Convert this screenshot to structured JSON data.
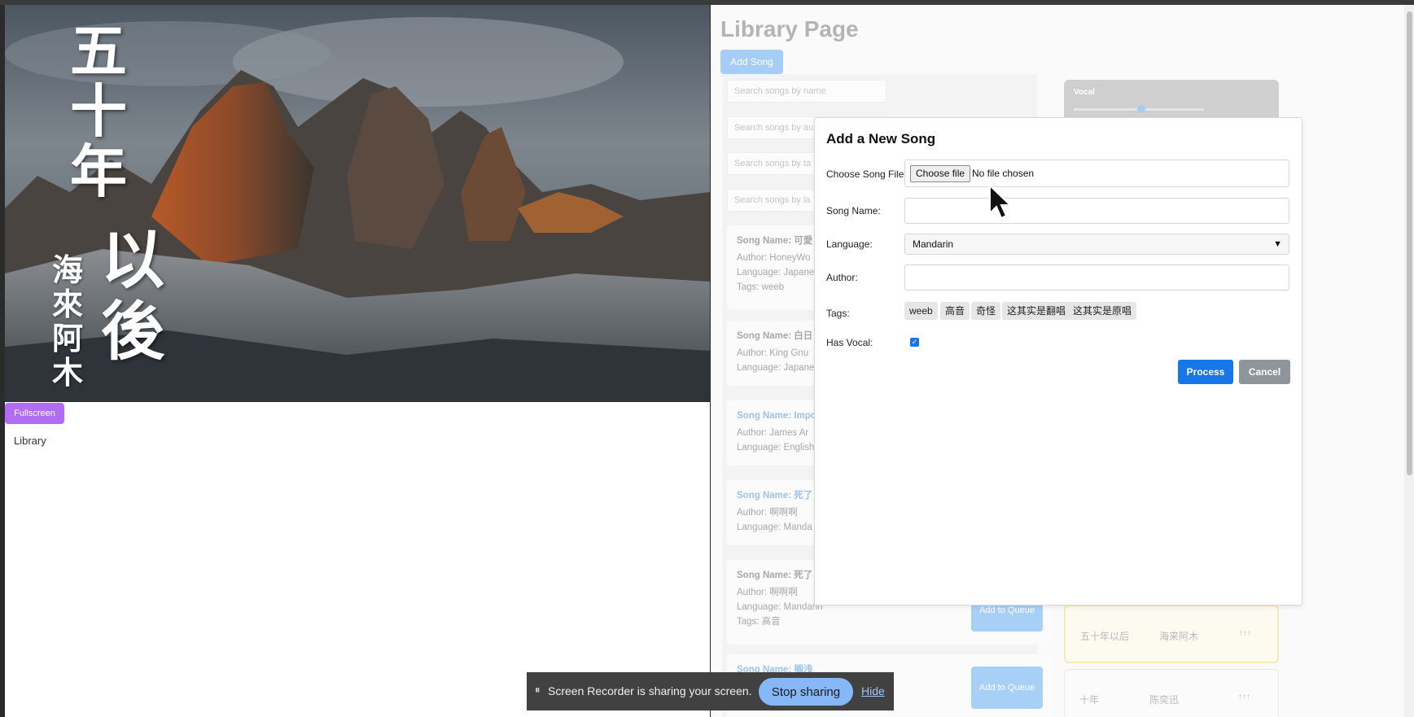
{
  "left": {
    "video_title_chars": "五十年",
    "video_title_chars2": "以後",
    "video_artist": "海來阿木",
    "fullscreen_label": "Fullscreen",
    "library_link": "Library"
  },
  "library": {
    "title": "Library Page",
    "add_song_label": "Add Song",
    "search_placeholders": [
      "Search songs by name",
      "Search songs by au",
      "Search songs by ta",
      "Search songs by la"
    ],
    "songs": [
      {
        "name": "Song Name: 可愛",
        "author": "Author: HoneyWo",
        "language": "Language: Japane",
        "tags": "Tags: weeb",
        "highlight": false
      },
      {
        "name": "Song Name: 白日",
        "author": "Author: King Gnu",
        "language": "Language: Japane",
        "tags": "",
        "highlight": false
      },
      {
        "name": "Song Name: Impo",
        "author": "Author: James Ar",
        "language": "Language: English",
        "tags": "",
        "highlight": true
      },
      {
        "name": "Song Name: 死了",
        "author": "Author: 啊啊啊",
        "language": "Language: Manda",
        "tags": "",
        "highlight": true
      },
      {
        "name": "Song Name: 死了",
        "author": "Author: 啊啊啊",
        "language": "Language: Mandarin",
        "tags": "Tags: 高音",
        "highlight": false
      },
      {
        "name": "Song Name: 搁浅",
        "author": "",
        "language": "",
        "tags": "",
        "highlight": true
      }
    ],
    "add_to_queue": "Add to Queue",
    "vocal_label": "Vocal",
    "queue": [
      {
        "title": "五十年以后",
        "artist": "海来阿木",
        "arrows": "↑↑↑"
      },
      {
        "title": "十年",
        "artist": "陈奕迅",
        "arrows": "↑↑↑"
      }
    ]
  },
  "modal": {
    "title": "Add a New Song",
    "choose_file_label": "Choose Song File:",
    "choose_file_button": "Choose file",
    "no_file_text": "No file chosen",
    "song_name_label": "Song Name:",
    "song_name_value": "",
    "language_label": "Language:",
    "language_value": "Mandarin",
    "author_label": "Author:",
    "author_value": "",
    "tags_label": "Tags:",
    "tags": [
      "weeb",
      "高音",
      "奇怪",
      "这其实是翻唱",
      "这其实是原唱"
    ],
    "has_vocal_label": "Has Vocal:",
    "has_vocal_checked": true,
    "process_label": "Process",
    "cancel_label": "Cancel"
  },
  "share_bar": {
    "pause_icon": "⏸",
    "message": "Screen Recorder is sharing your screen.",
    "stop_label": "Stop sharing",
    "hide_label": "Hide"
  },
  "colors": {
    "accent_blue": "#1877e8",
    "fullscreen_purple": "#b06df3",
    "cancel_gray": "#8e969c"
  }
}
